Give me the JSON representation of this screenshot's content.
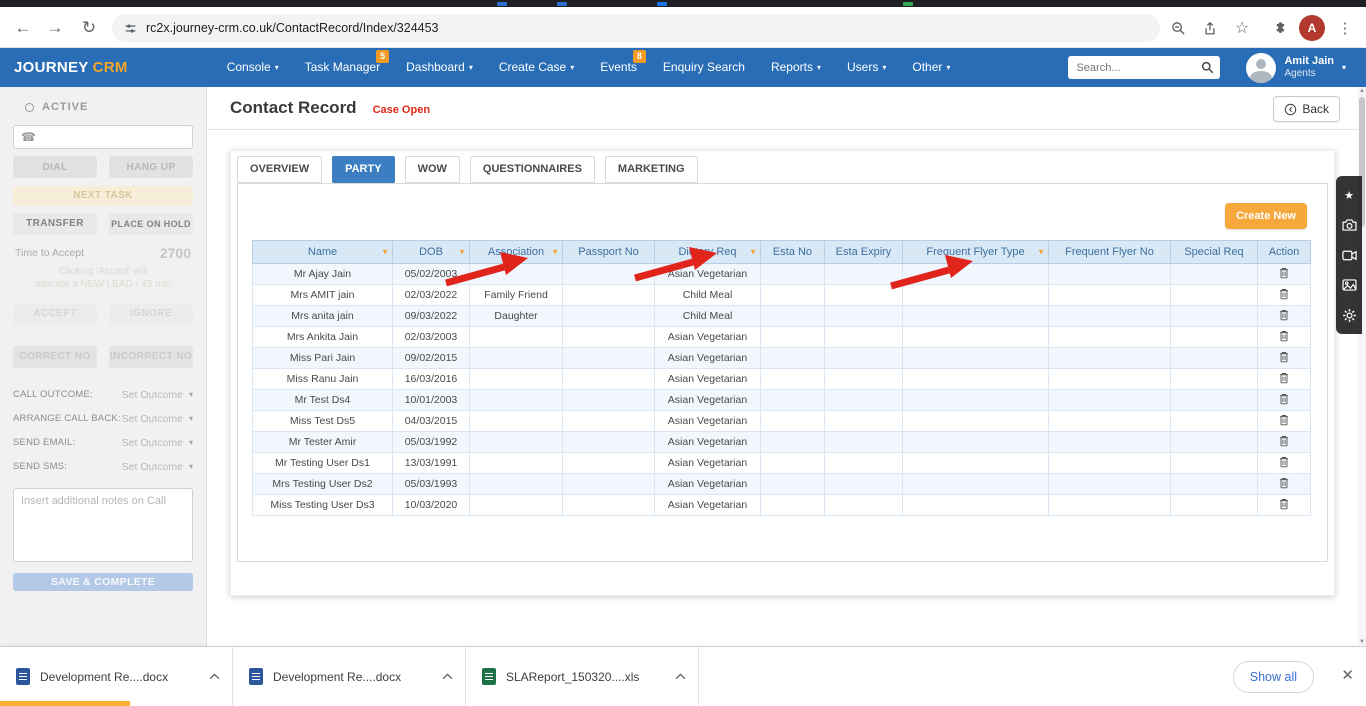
{
  "colors": {
    "navbar_blue": "#2a6db7",
    "brand_orange": "#f5a623",
    "active_tab_blue": "#3b7ec2",
    "table_header_bg": "#d9e8f5",
    "create_new_orange": "#f6a83c",
    "case_open_red": "#e12717",
    "annotation_red": "#e0241b",
    "save_button_blue": "#b3c9e6"
  },
  "browser": {
    "url": "rc2x.journey-crm.co.uk/ContactRecord/Index/324453",
    "profile_initial": "A"
  },
  "navbar": {
    "brand_primary": "JOURNEY",
    "brand_accent": "CRM",
    "items": [
      {
        "label": "Console",
        "caret": true,
        "badge": ""
      },
      {
        "label": "Task Manager",
        "caret": false,
        "badge": "5"
      },
      {
        "label": "Dashboard",
        "caret": true,
        "badge": ""
      },
      {
        "label": "Create Case",
        "caret": true,
        "badge": ""
      },
      {
        "label": "Events",
        "caret": false,
        "badge": "8"
      },
      {
        "label": "Enquiry Search",
        "caret": false,
        "badge": ""
      },
      {
        "label": "Reports",
        "caret": true,
        "badge": ""
      },
      {
        "label": "Users",
        "caret": true,
        "badge": ""
      },
      {
        "label": "Other",
        "caret": true,
        "badge": ""
      }
    ],
    "search_placeholder": "Search...",
    "user_name": "Amit Jain",
    "user_role": "Agents"
  },
  "sidebar": {
    "status_label": "ACTIVE",
    "dial_label": "DIAL",
    "hangup_label": "HANG UP",
    "next_task_label": "NEXT TASK",
    "transfer_label": "TRANSFER",
    "hold_label": "PLACE ON HOLD",
    "time_to_accept_label": "Time to Accept",
    "time_to_accept_value": "2700",
    "accept_note_line1": "Clicking 'Accept' will",
    "accept_note_line2": "allocate a NEW LEAD / 45 min",
    "accept_label": "ACCEPT",
    "ignore_label": "IGNORE",
    "correct_label": "CORRECT NO",
    "incorrect_label": "INCORRECT NO",
    "outcomes": [
      {
        "label": "CALL OUTCOME:",
        "value": "Set Outcome"
      },
      {
        "label": "ARRANGE CALL BACK:",
        "value": "Set Outcome"
      },
      {
        "label": "SEND EMAIL:",
        "value": "Set Outcome"
      },
      {
        "label": "SEND SMS:",
        "value": "Set Outcome"
      }
    ],
    "notes_placeholder": "Insert additional notes on Call",
    "save_label": "SAVE & COMPLETE"
  },
  "page": {
    "title": "Contact Record",
    "case_status": "Case Open",
    "back_label": "Back"
  },
  "tabs": [
    {
      "label": "OVERVIEW",
      "active": false
    },
    {
      "label": "PARTY",
      "active": true
    },
    {
      "label": "WOW",
      "active": false
    },
    {
      "label": "QUESTIONNAIRES",
      "active": false
    },
    {
      "label": "MARKETING",
      "active": false
    }
  ],
  "party": {
    "create_new_label": "Create New",
    "columns": [
      {
        "label": "Name",
        "filter": true
      },
      {
        "label": "DOB",
        "filter": true
      },
      {
        "label": "Association",
        "filter": true
      },
      {
        "label": "Passport No",
        "filter": false
      },
      {
        "label": "Dietary Req",
        "filter": true
      },
      {
        "label": "Esta No",
        "filter": false
      },
      {
        "label": "Esta Expiry",
        "filter": false
      },
      {
        "label": "Frequent Flyer Type",
        "filter": true
      },
      {
        "label": "Frequent Flyer No",
        "filter": false
      },
      {
        "label": "Special Req",
        "filter": false
      },
      {
        "label": "Action",
        "filter": false
      }
    ],
    "rows": [
      {
        "name": "Mr Ajay Jain",
        "dob": "05/02/2003",
        "association": "",
        "passport_no": "",
        "dietary_req": "Asian Vegetarian",
        "esta_no": "",
        "esta_expiry": "",
        "frequent_flyer_type": "",
        "frequent_flyer_no": "",
        "special_req": ""
      },
      {
        "name": "Mrs AMIT jain",
        "dob": "02/03/2022",
        "association": "Family Friend",
        "passport_no": "",
        "dietary_req": "Child Meal",
        "esta_no": "",
        "esta_expiry": "",
        "frequent_flyer_type": "",
        "frequent_flyer_no": "",
        "special_req": ""
      },
      {
        "name": "Mrs anita jain",
        "dob": "09/03/2022",
        "association": "Daughter",
        "passport_no": "",
        "dietary_req": "Child Meal",
        "esta_no": "",
        "esta_expiry": "",
        "frequent_flyer_type": "",
        "frequent_flyer_no": "",
        "special_req": ""
      },
      {
        "name": "Mrs Ankita Jain",
        "dob": "02/03/2003",
        "association": "",
        "passport_no": "",
        "dietary_req": "Asian Vegetarian",
        "esta_no": "",
        "esta_expiry": "",
        "frequent_flyer_type": "",
        "frequent_flyer_no": "",
        "special_req": ""
      },
      {
        "name": "Miss Pari Jain",
        "dob": "09/02/2015",
        "association": "",
        "passport_no": "",
        "dietary_req": "Asian Vegetarian",
        "esta_no": "",
        "esta_expiry": "",
        "frequent_flyer_type": "",
        "frequent_flyer_no": "",
        "special_req": ""
      },
      {
        "name": "Miss Ranu Jain",
        "dob": "16/03/2016",
        "association": "",
        "passport_no": "",
        "dietary_req": "Asian Vegetarian",
        "esta_no": "",
        "esta_expiry": "",
        "frequent_flyer_type": "",
        "frequent_flyer_no": "",
        "special_req": ""
      },
      {
        "name": "Mr Test Ds4",
        "dob": "10/01/2003",
        "association": "",
        "passport_no": "",
        "dietary_req": "Asian Vegetarian",
        "esta_no": "",
        "esta_expiry": "",
        "frequent_flyer_type": "",
        "frequent_flyer_no": "",
        "special_req": ""
      },
      {
        "name": "Miss Test Ds5",
        "dob": "04/03/2015",
        "association": "",
        "passport_no": "",
        "dietary_req": "Asian Vegetarian",
        "esta_no": "",
        "esta_expiry": "",
        "frequent_flyer_type": "",
        "frequent_flyer_no": "",
        "special_req": ""
      },
      {
        "name": "Mr Tester Amir",
        "dob": "05/03/1992",
        "association": "",
        "passport_no": "",
        "dietary_req": "Asian Vegetarian",
        "esta_no": "",
        "esta_expiry": "",
        "frequent_flyer_type": "",
        "frequent_flyer_no": "",
        "special_req": ""
      },
      {
        "name": "Mr Testing User Ds1",
        "dob": "13/03/1991",
        "association": "",
        "passport_no": "",
        "dietary_req": "Asian Vegetarian",
        "esta_no": "",
        "esta_expiry": "",
        "frequent_flyer_type": "",
        "frequent_flyer_no": "",
        "special_req": ""
      },
      {
        "name": "Mrs Testing User Ds2",
        "dob": "05/03/1993",
        "association": "",
        "passport_no": "",
        "dietary_req": "Asian Vegetarian",
        "esta_no": "",
        "esta_expiry": "",
        "frequent_flyer_type": "",
        "frequent_flyer_no": "",
        "special_req": ""
      },
      {
        "name": "Miss Testing User Ds3",
        "dob": "10/03/2020",
        "association": "",
        "passport_no": "",
        "dietary_req": "Asian Vegetarian",
        "esta_no": "",
        "esta_expiry": "",
        "frequent_flyer_type": "",
        "frequent_flyer_no": "",
        "special_req": ""
      }
    ]
  },
  "downloads": {
    "files": [
      {
        "name": "Development Re....docx",
        "kind": "word"
      },
      {
        "name": "Development Re....docx",
        "kind": "word"
      },
      {
        "name": "SLAReport_150320....xls",
        "kind": "excel"
      }
    ],
    "show_all_label": "Show all"
  }
}
